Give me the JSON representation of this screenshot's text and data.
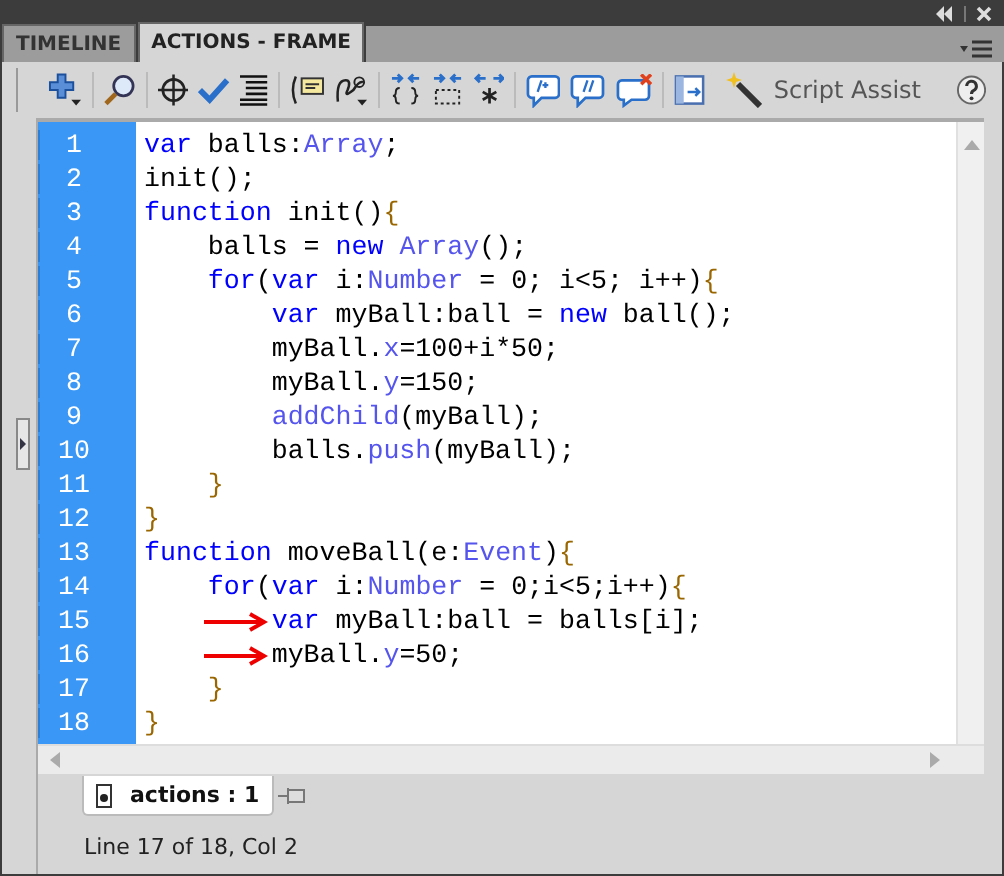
{
  "tabs": [
    {
      "label": "TIMELINE",
      "selected": false
    },
    {
      "label": "ACTIONS - FRAME",
      "selected": true
    }
  ],
  "toolbar": {
    "script_assist": "Script Assist"
  },
  "code": [
    {
      "number": "1",
      "marked": false,
      "tokens": [
        {
          "kind": "keyword",
          "text": "var"
        },
        {
          "kind": "plain",
          "text": " balls:"
        },
        {
          "kind": "builtin",
          "text": "Array"
        },
        {
          "kind": "plain",
          "text": ";"
        }
      ]
    },
    {
      "number": "2",
      "marked": false,
      "tokens": [
        {
          "kind": "plain",
          "text": "init();"
        }
      ]
    },
    {
      "number": "3",
      "marked": false,
      "tokens": [
        {
          "kind": "keyword",
          "text": "function"
        },
        {
          "kind": "plain",
          "text": " init()"
        },
        {
          "kind": "brace",
          "text": "{"
        }
      ]
    },
    {
      "number": "4",
      "marked": false,
      "tokens": [
        {
          "kind": "plain",
          "text": "    balls = "
        },
        {
          "kind": "keyword",
          "text": "new"
        },
        {
          "kind": "builtin",
          "text": " Array"
        },
        {
          "kind": "plain",
          "text": "();"
        }
      ]
    },
    {
      "number": "5",
      "marked": false,
      "tokens": [
        {
          "kind": "keyword",
          "text": "    for"
        },
        {
          "kind": "plain",
          "text": "("
        },
        {
          "kind": "keyword",
          "text": "var"
        },
        {
          "kind": "plain",
          "text": " i:"
        },
        {
          "kind": "builtin",
          "text": "Number"
        },
        {
          "kind": "plain",
          "text": " = 0; i<5; i++)"
        },
        {
          "kind": "brace",
          "text": "{"
        }
      ]
    },
    {
      "number": "6",
      "marked": false,
      "tokens": [
        {
          "kind": "keyword",
          "text": "        var"
        },
        {
          "kind": "plain",
          "text": " myBall:ball = "
        },
        {
          "kind": "keyword",
          "text": "new"
        },
        {
          "kind": "plain",
          "text": " ball();"
        }
      ]
    },
    {
      "number": "7",
      "marked": false,
      "tokens": [
        {
          "kind": "plain",
          "text": "        myBall."
        },
        {
          "kind": "builtin",
          "text": "x"
        },
        {
          "kind": "plain",
          "text": "=100+i*50;"
        }
      ]
    },
    {
      "number": "8",
      "marked": false,
      "tokens": [
        {
          "kind": "plain",
          "text": "        myBall."
        },
        {
          "kind": "builtin",
          "text": "y"
        },
        {
          "kind": "plain",
          "text": "=150;"
        }
      ]
    },
    {
      "number": "9",
      "marked": false,
      "tokens": [
        {
          "kind": "builtin",
          "text": "        addChild"
        },
        {
          "kind": "plain",
          "text": "(myBall);"
        }
      ]
    },
    {
      "number": "10",
      "marked": false,
      "tokens": [
        {
          "kind": "plain",
          "text": "        balls."
        },
        {
          "kind": "builtin",
          "text": "push"
        },
        {
          "kind": "plain",
          "text": "(myBall);"
        }
      ]
    },
    {
      "number": "11",
      "marked": false,
      "tokens": [
        {
          "kind": "brace",
          "text": "    }"
        }
      ]
    },
    {
      "number": "12",
      "marked": false,
      "tokens": [
        {
          "kind": "brace",
          "text": "}"
        }
      ]
    },
    {
      "number": "13",
      "marked": false,
      "tokens": [
        {
          "kind": "keyword",
          "text": "function"
        },
        {
          "kind": "plain",
          "text": " moveBall(e:"
        },
        {
          "kind": "builtin",
          "text": "Event"
        },
        {
          "kind": "plain",
          "text": ")"
        },
        {
          "kind": "brace",
          "text": "{"
        }
      ]
    },
    {
      "number": "14",
      "marked": false,
      "tokens": [
        {
          "kind": "keyword",
          "text": "    for"
        },
        {
          "kind": "plain",
          "text": "("
        },
        {
          "kind": "keyword",
          "text": "var"
        },
        {
          "kind": "plain",
          "text": " i:"
        },
        {
          "kind": "builtin",
          "text": "Number"
        },
        {
          "kind": "plain",
          "text": " = 0;i<5;i++)"
        },
        {
          "kind": "brace",
          "text": "{"
        }
      ]
    },
    {
      "number": "15",
      "marked": true,
      "tokens": [
        {
          "kind": "keyword",
          "text": "        var"
        },
        {
          "kind": "plain",
          "text": " myBall:ball = balls[i];"
        }
      ]
    },
    {
      "number": "16",
      "marked": true,
      "tokens": [
        {
          "kind": "plain",
          "text": "        myBall."
        },
        {
          "kind": "builtin",
          "text": "y"
        },
        {
          "kind": "plain",
          "text": "=50;"
        }
      ]
    },
    {
      "number": "17",
      "marked": false,
      "tokens": [
        {
          "kind": "brace",
          "text": "    }"
        }
      ]
    },
    {
      "number": "18",
      "marked": false,
      "tokens": [
        {
          "kind": "brace",
          "text": "}"
        }
      ]
    }
  ],
  "script_tab": {
    "label": "actions : 1"
  },
  "status_bar": "Line 17 of 18, Col 2"
}
